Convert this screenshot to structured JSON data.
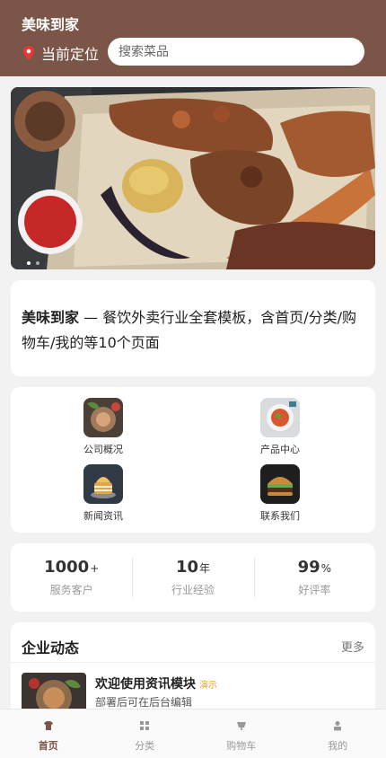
{
  "header": {
    "app_title": "美味到家",
    "location_label": "当前定位",
    "search_placeholder": "搜索菜品"
  },
  "intro": {
    "brand": "美味到家",
    "text": " — 餐饮外卖行业全套模板，含首页/分类/购物车/我的等10个页面"
  },
  "grid": {
    "items": [
      {
        "label": "公司概况"
      },
      {
        "label": "产品中心"
      },
      {
        "label": "新闻资讯"
      },
      {
        "label": "联系我们"
      }
    ]
  },
  "stats": [
    {
      "value": "1000",
      "unit": "+",
      "label": "服务客户"
    },
    {
      "value": "10",
      "unit": "年",
      "label": "行业经验"
    },
    {
      "value": "99",
      "unit": "%",
      "label": "好评率"
    }
  ],
  "news": {
    "title": "企业动态",
    "more": "更多",
    "items": [
      {
        "headline": "欢迎使用资讯模块",
        "badge": "演示",
        "subtitle": "部署后可在后台编辑"
      }
    ]
  },
  "tabbar": {
    "tabs": [
      {
        "label": "首页",
        "icon": "shirt-icon"
      },
      {
        "label": "分类",
        "icon": "grid-icon"
      },
      {
        "label": "购物车",
        "icon": "cart-icon"
      },
      {
        "label": "我的",
        "icon": "user-icon"
      }
    ],
    "active": 0
  },
  "colors": {
    "brand": "#7a5548",
    "badge": "#e6a23c"
  }
}
